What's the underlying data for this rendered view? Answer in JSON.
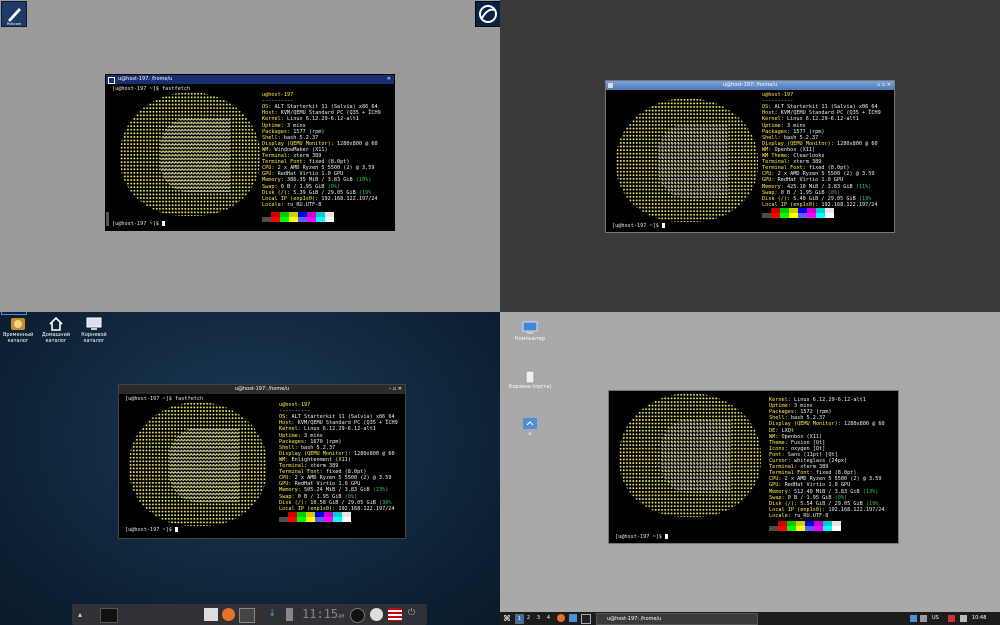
{
  "terminals": {
    "q1": {
      "title": "u@host-197: /home/u",
      "command_line": "[u@host-197 ~]$ fastfetch",
      "final_prompt": "[u@host-197 ~]$ ",
      "user_host": "u@host-197",
      "rule": "----------",
      "info": [
        {
          "k": "OS:",
          "v": " ALT Starterkit 11 (Salvia) x86_64"
        },
        {
          "k": "Host:",
          "v": " KVM/QEMU Standard PC (Q35 + ICH9"
        },
        {
          "k": "Kernel:",
          "v": " Linux 6.12.29-6.12-alt1"
        },
        {
          "k": "Uptime:",
          "v": " 3 mins"
        },
        {
          "k": "Packages:",
          "v": " 1577 (rpm)"
        },
        {
          "k": "Shell:",
          "v": " bash 5.2.37"
        },
        {
          "k": "Display (QEMU Monitor):",
          "v": " 1280x800 @ 60"
        },
        {
          "k": "WM:",
          "v": " WindowMaker (X11)"
        },
        {
          "k": "Terminal:",
          "v": " xterm 389"
        },
        {
          "k": "Terminal Font:",
          "v": " fixed (8.0pt)"
        },
        {
          "k": "CPU:",
          "v": " 2 x AMD Ryzen 5 5500 (2) @ 3.59"
        },
        {
          "k": "GPU:",
          "v": " RedHat Virtio 1.0 GPU"
        },
        {
          "k": "Memory:",
          "v": " 386.35 MiB / 3.83 GiB ",
          "g": "(10%)"
        },
        {
          "k": "Swap:",
          "v": " 0 B / 1.95 GiB ",
          "g": "(0%)"
        },
        {
          "k": "Disk (/):",
          "v": " 5.39 GiB / 29.05 GiB ",
          "g": "(19%"
        },
        {
          "k": "Local IP (enp1s0):",
          "v": " 192.168.122.197/24"
        },
        {
          "k": "Locale:",
          "v": " ru_RU.UTF-8"
        }
      ]
    },
    "q2": {
      "title": "u@host-197: /home/u",
      "final_prompt": "[u@host-197 ~]$ ",
      "user_host": "u@host-197",
      "rule": "----------",
      "info": [
        {
          "k": "OS:",
          "v": " ALT Starterkit 11 (Salvia) x86_64"
        },
        {
          "k": "Host:",
          "v": " KVM/QEMU Standard PC (Q35 + ICH9"
        },
        {
          "k": "Kernel:",
          "v": " Linux 6.12.29-6.12-alt1"
        },
        {
          "k": "Uptime:",
          "v": " 3 mins"
        },
        {
          "k": "Packages:",
          "v": " 1577 (rpm)"
        },
        {
          "k": "Shell:",
          "v": " bash 5.2.37"
        },
        {
          "k": "Display (QEMU Monitor):",
          "v": " 1280x800 @ 60"
        },
        {
          "k": "WM:",
          "v": " Openbox (X11)"
        },
        {
          "k": "WM Theme:",
          "v": " Clearlooks"
        },
        {
          "k": "Terminal:",
          "v": " xterm 389"
        },
        {
          "k": "Terminal Font:",
          "v": " fixed (8.0pt)"
        },
        {
          "k": "CPU:",
          "v": " 2 x AMD Ryzen 5 5500 (2) @ 3.59"
        },
        {
          "k": "GPU:",
          "v": " RedHat Virtio 1.0 GPU"
        },
        {
          "k": "Memory:",
          "v": " 425.10 MiB / 3.83 GiB ",
          "g": "(11%)"
        },
        {
          "k": "Swap:",
          "v": " 0 B / 1.95 GiB ",
          "g": "(0%)"
        },
        {
          "k": "Disk (/):",
          "v": " 5.40 GiB / 29.05 GiB ",
          "g": "(19%"
        },
        {
          "k": "Local IP (enp1s0):",
          "v": " 192.168.122.197/24"
        },
        {
          "k": "Locale:",
          "v": " ru_RU.UTF-8"
        }
      ]
    },
    "q3": {
      "title": "u@host-197: /home/u",
      "command_line": "[u@host-197 ~]$ fastfetch",
      "final_prompt": "[u@host-197 ~]$ ",
      "user_host": "u@host-197",
      "rule": "----------",
      "info": [
        {
          "k": "OS:",
          "v": " ALT Starterkit 11 (Salvia) x86_64"
        },
        {
          "k": "Host:",
          "v": " KVM/QEMU Standard PC (Q35 + ICH9"
        },
        {
          "k": "Kernel:",
          "v": " Linux 6.12.29-6.12-alt1"
        },
        {
          "k": "Uptime:",
          "v": " 3 mins"
        },
        {
          "k": "Packages:",
          "v": " 1670 (rpm)"
        },
        {
          "k": "Shell:",
          "v": " bash 5.2.37"
        },
        {
          "k": "Display (QEMU Monitor):",
          "v": " 1280x800 @ 60"
        },
        {
          "k": "WM:",
          "v": " Enlightenment (X11)"
        },
        {
          "k": "Terminal:",
          "v": " xterm 389"
        },
        {
          "k": "Terminal Font:",
          "v": " fixed (8.0pt)"
        },
        {
          "k": "CPU:",
          "v": " 2 x AMD Ryzen 5 5500 (2) @ 3.59"
        },
        {
          "k": "GPU:",
          "v": " RedHat Virtio 1.0 GPU"
        },
        {
          "k": "Memory:",
          "v": " 505.24 MiB / 3.83 GiB ",
          "g": "(13%)"
        },
        {
          "k": "Swap:",
          "v": " 0 B / 1.95 GiB ",
          "g": "(0%)"
        },
        {
          "k": "Disk (/):",
          "v": " 10.58 GiB / 29.05 GiB ",
          "g": "(36%"
        },
        {
          "k": "Local IP (enp1s0):",
          "v": " 192.168.122.197/24"
        },
        {
          "k": "Locale:",
          "v": " ru_RU.UTF-8"
        }
      ]
    },
    "q4": {
      "final_prompt": "[u@host-197 ~]$ ",
      "info": [
        {
          "k": "Kernel:",
          "v": " Linux 6.12.29-6.12-alt1"
        },
        {
          "k": "Uptime:",
          "v": " 3 mins"
        },
        {
          "k": "Packages:",
          "v": " 1572 (rpm)"
        },
        {
          "k": "Shell:",
          "v": " bash 5.2.37"
        },
        {
          "k": "Display (QEMU Monitor):",
          "v": " 1280x800 @ 60"
        },
        {
          "k": "DE:",
          "v": " LXQt"
        },
        {
          "k": "WM:",
          "v": " Openbox (X11)"
        },
        {
          "k": "Theme:",
          "v": " Fusion [Qt]"
        },
        {
          "k": "Icons:",
          "v": " oxygen [Qt]"
        },
        {
          "k": "Font:",
          "v": " Sans (11pt) [Qt]"
        },
        {
          "k": "Cursor:",
          "v": " whiteglass (24px)"
        },
        {
          "k": "Terminal:",
          "v": " xterm 389"
        },
        {
          "k": "Terminal Font:",
          "v": " fixed (8.0pt)"
        },
        {
          "k": "CPU:",
          "v": " 2 x AMD Ryzen 5 5500 (2) @ 3.59"
        },
        {
          "k": "GPU:",
          "v": " RedHat Virtio 1.0 GPU"
        },
        {
          "k": "Memory:",
          "v": " 512.40 MiB / 3.83 GiB ",
          "g": "(13%)"
        },
        {
          "k": "Swap:",
          "v": " 0 B / 1.95 GiB ",
          "g": "(0%)"
        },
        {
          "k": "Disk (/):",
          "v": " 5.54 GiB / 29.05 GiB ",
          "g": "(19%"
        },
        {
          "k": "Local IP (enp1s0):",
          "v": " 192.168.122.197/24"
        },
        {
          "k": "Locale:",
          "v": " ru_RU.UTF-8"
        }
      ]
    }
  },
  "palette": {
    "row1": [
      "#000000",
      "#cd0000",
      "#00cd00",
      "#cdcd00",
      "#0000ee",
      "#cd00cd",
      "#00cdcd",
      "#e5e5e5"
    ],
    "row2": [
      "#4d4d4d",
      "#ff0000",
      "#00ff00",
      "#ffff00",
      "#5c5cff",
      "#ff00ff",
      "#00ffff",
      "#ffffff"
    ]
  },
  "q1_desktop": {
    "dock_top_left_label": "Polkcom"
  },
  "q3_desktop": {
    "icons": [
      {
        "label": "Временный каталог",
        "icon": "clock-folder-icon"
      },
      {
        "label": "Домашний каталог",
        "icon": "home-icon"
      },
      {
        "label": "Корневой каталог",
        "icon": "computer-icon"
      }
    ],
    "taskbar": {
      "clock": "11:15",
      "clock_suffix": "AM"
    }
  },
  "q4_desktop": {
    "icons": [
      {
        "label": "Компьютер",
        "icon": "computer-icon"
      },
      {
        "label": "Корзина (пуста)",
        "icon": "trash-icon"
      },
      {
        "label": "u",
        "icon": "home-folder-icon"
      }
    ],
    "panel": {
      "workspaces": [
        "1",
        "2",
        "3",
        "4"
      ],
      "task_label": "u@host-197: /home/u",
      "layout": "US",
      "clock": "10:48"
    }
  }
}
